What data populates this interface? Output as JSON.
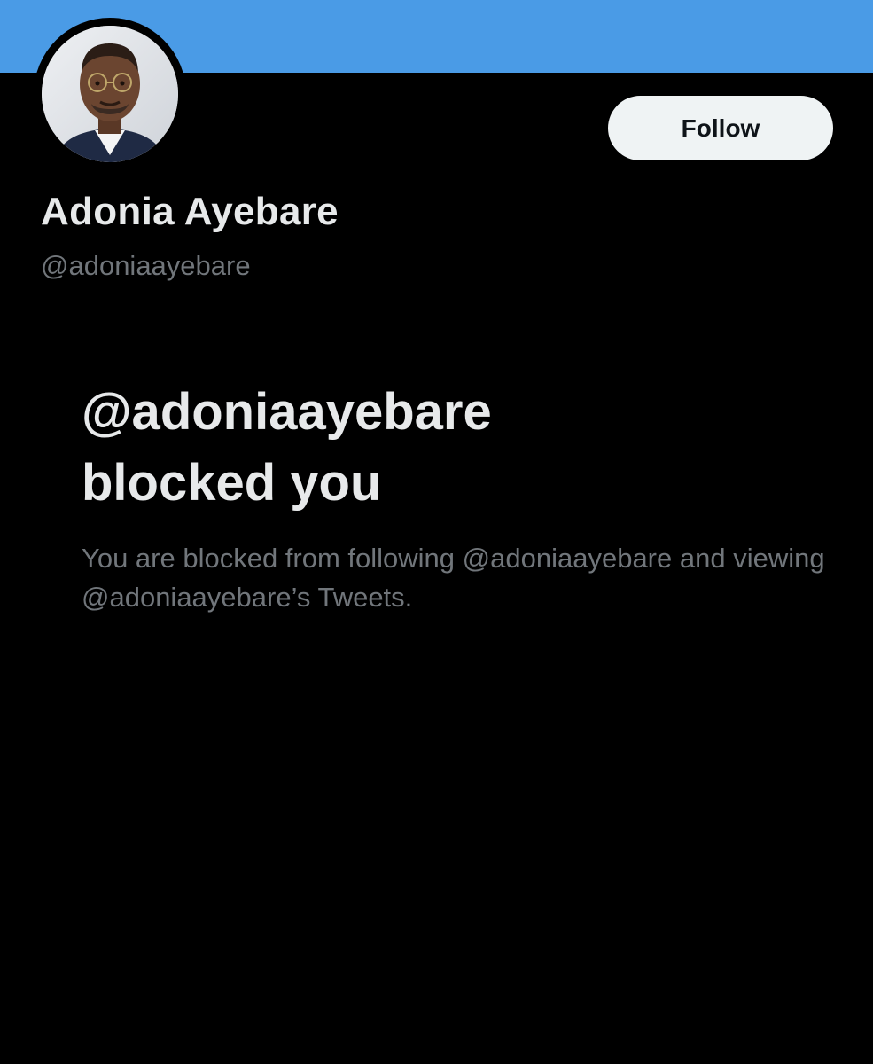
{
  "colors": {
    "banner": "#4a9be6",
    "background": "#000000",
    "primary_text": "#e7e9ea",
    "secondary_text": "#71767b",
    "follow_button_bg": "#eff3f4",
    "follow_button_text": "#0f1419"
  },
  "profile": {
    "avatar_icon": "profile-photo",
    "display_name": "Adonia Ayebare",
    "handle": "@adoniaayebare",
    "follow_label": "Follow"
  },
  "blocked_notice": {
    "title_line1": "@adoniaayebare",
    "title_line2": "blocked you",
    "description": "You are blocked from following @adoniaayebare and viewing @adoniaayebare’s Tweets."
  }
}
